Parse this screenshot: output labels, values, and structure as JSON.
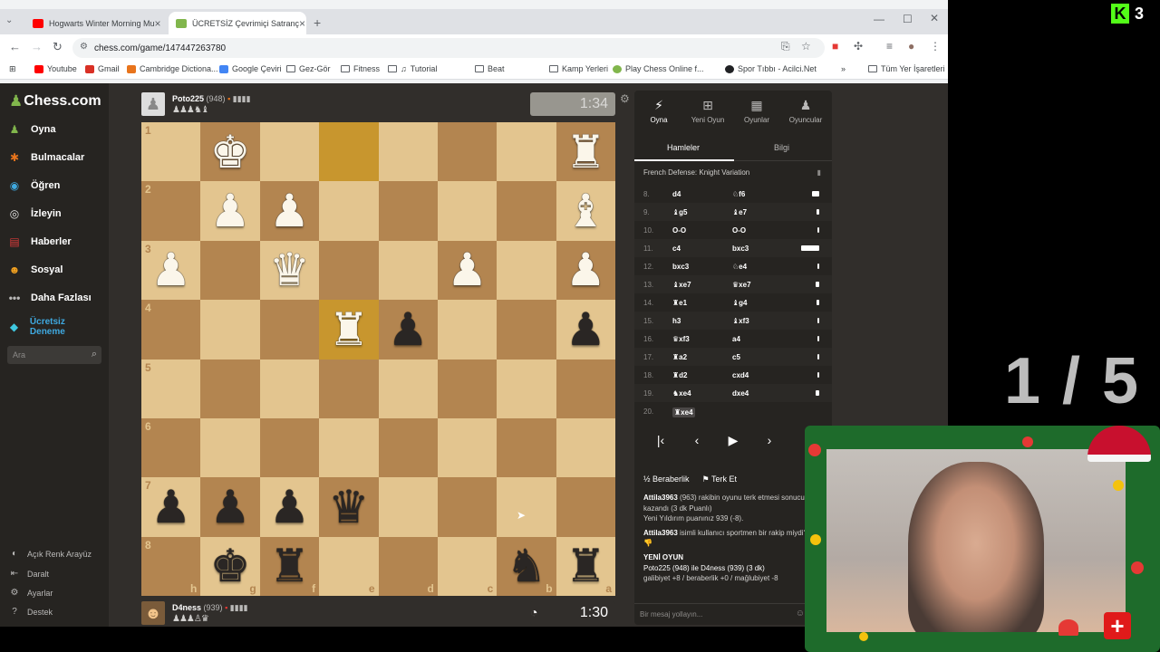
{
  "browser": {
    "tabs": [
      {
        "title": "Hogwarts Winter Morning Mu",
        "favicon_color": "#ff0000"
      },
      {
        "title": "ÜCRETSİZ Çevrimiçi Satranç",
        "favicon_color": "#81b64c"
      }
    ],
    "url": "chess.com/game/147447263780",
    "bookmarks": [
      "Youtube",
      "Gmail",
      "Cambridge Dictiona...",
      "Google Çeviri",
      "Gez-Gör",
      "Fitness",
      "Tutorial",
      "Beat",
      "Kamp Yerleri",
      "Play Chess Online f...",
      "Spor Tıbbı - Acilci.Net"
    ],
    "all_bookmarks": "Tüm Yer İşaretleri"
  },
  "nav": {
    "logo": "Chess.com",
    "items": [
      {
        "label": "Oyna",
        "icon": "pawn-icon",
        "color": "#81b64c"
      },
      {
        "label": "Bulmacalar",
        "icon": "puzzle-icon",
        "color": "#e8741c"
      },
      {
        "label": "Öğren",
        "icon": "learn-icon",
        "color": "#3fa9e0"
      },
      {
        "label": "İzleyin",
        "icon": "binoculars-icon",
        "color": "#e6e6e6"
      },
      {
        "label": "Haberler",
        "icon": "news-icon",
        "color": "#d93a3a"
      },
      {
        "label": "Sosyal",
        "icon": "social-icon",
        "color": "#f0a020"
      },
      {
        "label": "Daha Fazlası",
        "icon": "more-icon",
        "color": "#bab9b8"
      }
    ],
    "trial": "Ücretsiz Deneme",
    "search_placeholder": "Ara",
    "footer": [
      "Açık Renk Arayüz",
      "Daralt",
      "Ayarlar",
      "Destek"
    ]
  },
  "top_player": {
    "name": "Poto225",
    "rating": "(948)",
    "clock": "1:34",
    "captured": "♟♟♟♞♝"
  },
  "bottom_player": {
    "name": "D4ness",
    "rating": "(939)",
    "clock": "1:30",
    "captured": "♟♟♟♙♛"
  },
  "board": {
    "ranks": [
      "1",
      "2",
      "3",
      "4",
      "5",
      "6",
      "7",
      "8"
    ],
    "files": [
      "h",
      "g",
      "f",
      "e",
      "d",
      "c",
      "b",
      "a"
    ],
    "highlight": [
      "e1",
      "e4"
    ],
    "rows": [
      [
        "",
        "wK",
        "",
        "",
        "",
        "",
        "",
        "wR"
      ],
      [
        "",
        "wP",
        "wP",
        "",
        "",
        "",
        "",
        "wB"
      ],
      [
        "wP",
        "",
        "wQ",
        "",
        "",
        "wP",
        "",
        "wP"
      ],
      [
        "",
        "",
        "",
        "wR",
        "bP",
        "",
        "",
        "bP"
      ],
      [
        "",
        "",
        "",
        "",
        "",
        "",
        "",
        ""
      ],
      [
        "",
        "",
        "",
        "",
        "",
        "",
        "",
        ""
      ],
      [
        "bP",
        "bP",
        "bP",
        "bQ",
        "",
        "",
        "",
        ""
      ],
      [
        "",
        "bK",
        "bR",
        "",
        "",
        "",
        "bN",
        "bR"
      ]
    ]
  },
  "panel": {
    "tabs": [
      {
        "label": "Oyna",
        "icon": "bolt-icon"
      },
      {
        "label": "Yeni Oyun",
        "icon": "plus-icon"
      },
      {
        "label": "Oyunlar",
        "icon": "board-icon"
      },
      {
        "label": "Oyuncular",
        "icon": "players-icon"
      }
    ],
    "subtabs": [
      "Hamleler",
      "Bilgi"
    ],
    "opening": "French Defense: Knight Variation",
    "moves": [
      {
        "n": "8.",
        "w": "d4",
        "b": "♘f6",
        "bar": 8
      },
      {
        "n": "9.",
        "w": "♝g5",
        "b": "♝e7",
        "bar": 3
      },
      {
        "n": "10.",
        "w": "O-O",
        "b": "O-O",
        "bar": 2
      },
      {
        "n": "11.",
        "w": "c4",
        "b": "bxc3",
        "bar": 20
      },
      {
        "n": "12.",
        "w": "bxc3",
        "b": "♘e4",
        "bar": 2
      },
      {
        "n": "13.",
        "w": "♝xe7",
        "b": "♛xe7",
        "bar": 4
      },
      {
        "n": "14.",
        "w": "♜e1",
        "b": "♝g4",
        "bar": 3
      },
      {
        "n": "15.",
        "w": "h3",
        "b": "♝xf3",
        "bar": 2
      },
      {
        "n": "16.",
        "w": "♛xf3",
        "b": "a4",
        "bar": 2
      },
      {
        "n": "17.",
        "w": "♜a2",
        "b": "c5",
        "bar": 2
      },
      {
        "n": "18.",
        "w": "♜d2",
        "b": "cxd4",
        "bar": 2
      },
      {
        "n": "19.",
        "w": "♞xe4",
        "b": "dxe4",
        "bar": 4
      },
      {
        "n": "20.",
        "w": "♜xe4",
        "b": "",
        "bar": 0
      }
    ],
    "controls": [
      "⏮",
      "‹",
      "›",
      "›|"
    ],
    "draw": "½ Beraberlik",
    "resign": "Terk Et",
    "chat": {
      "l1_user": "Attila3963",
      "l1_text": "(963) rakibin oyunu terk etmesi sonucu kazandı (3 dk Puanlı)",
      "l2": "Yeni Yıldırım puanınız 939 (-8).",
      "l3_user": "Attila3963",
      "l3_text": "isimli kullanıcı sportmen bir rakip miydi?",
      "new_game": "YENİ OYUN",
      "l4": "Poto225 (948) ile D4ness (939) (3 dk)",
      "l5": "galibiyet +8 / beraberlik +0 / mağlubiyet -8"
    },
    "chat_placeholder": "Bir mesaj yollayın..."
  },
  "overlay": {
    "kick_letter": "K",
    "kick_count": "3",
    "counter": "1 / 5"
  }
}
